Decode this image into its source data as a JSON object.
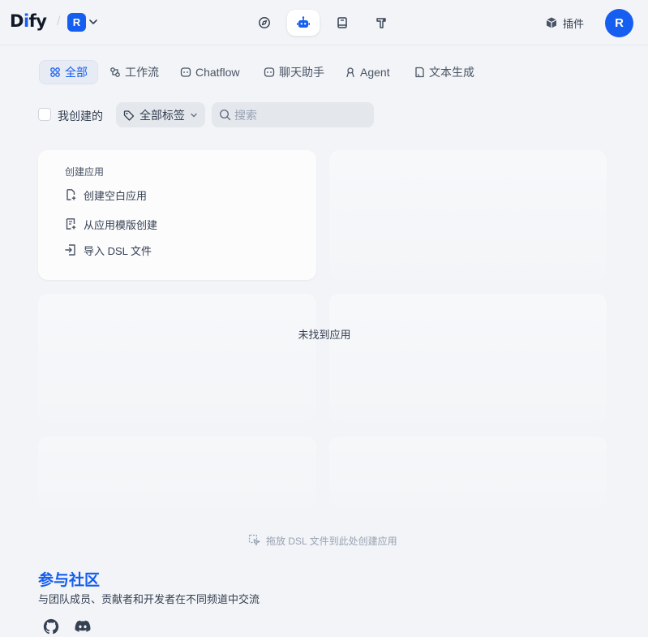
{
  "header": {
    "logo": {
      "before": "D",
      "accent": "i",
      "after": "fy"
    },
    "workspace_initial": "R",
    "nav": [
      {
        "name": "explore",
        "icon": "compass-icon"
      },
      {
        "name": "studio",
        "icon": "robot-icon",
        "active": true
      },
      {
        "name": "knowledge",
        "icon": "book-icon"
      },
      {
        "name": "tools",
        "icon": "hammer-icon"
      }
    ],
    "plugins_label": "插件",
    "avatar_initial": "R"
  },
  "tabs": [
    {
      "label": "全部",
      "icon": "grid-icon",
      "active": true
    },
    {
      "label": "工作流",
      "icon": "workflow-icon"
    },
    {
      "label": "Chatflow",
      "icon": "chatflow-icon"
    },
    {
      "label": "聊天助手",
      "icon": "chat-bubble-icon"
    },
    {
      "label": "Agent",
      "icon": "agent-icon"
    },
    {
      "label": "文本生成",
      "icon": "document-icon"
    }
  ],
  "filters": {
    "created_by_me": "我创建的",
    "tags": "全部标签",
    "search_placeholder": "搜索"
  },
  "create_card": {
    "title": "创建应用",
    "items": [
      {
        "label": "创建空白应用",
        "icon": "new-file-icon"
      },
      {
        "label": "从应用模版创建",
        "icon": "template-icon"
      },
      {
        "label": "导入 DSL 文件",
        "icon": "import-icon"
      }
    ]
  },
  "empty_state": "未找到应用",
  "drop_hint": "拖放 DSL 文件到此处创建应用",
  "community": {
    "title": "参与社区",
    "description": "与团队成员、贡献者和开发者在不同频道中交流"
  },
  "colors": {
    "accent": "#155eef",
    "background": "#f2f4f7"
  }
}
